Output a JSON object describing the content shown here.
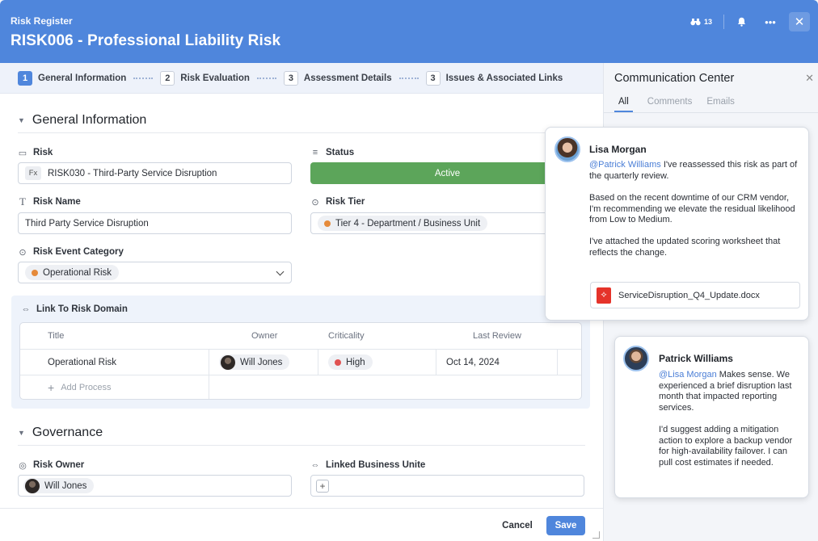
{
  "header": {
    "breadcrumb": "Risk Register",
    "title": "RISK006 - Professional Liability Risk",
    "watchers_count": "13",
    "icons": [
      "binoculars-icon",
      "bell-icon",
      "more-icon",
      "close-icon"
    ]
  },
  "steps": [
    {
      "num": "1",
      "label": "General Information"
    },
    {
      "num": "2",
      "label": "Risk Evaluation"
    },
    {
      "num": "3",
      "label": "Assessment Details"
    },
    {
      "num": "3",
      "label": "Issues & Associated Links"
    }
  ],
  "general": {
    "section_title": "General Information",
    "risk_label": "Risk",
    "risk_fx": "Fx",
    "risk_value": "RISK030 - Third-Party Service Disruption",
    "status_label": "Status",
    "status_value": "Active",
    "risk_name_label": "Risk Name",
    "risk_name_value": "Third Party Service Disruption",
    "risk_tier_label": "Risk Tier",
    "risk_tier_value": "Tier 4 - Department / Business Unit",
    "event_category_label": "Risk Event Category",
    "event_category_value": "Operational Risk"
  },
  "domain": {
    "title": "Link To Risk Domain",
    "columns": [
      "Title",
      "Owner",
      "Criticality",
      "Last Review"
    ],
    "row": {
      "title": "Operational Risk",
      "owner": "Will Jones",
      "criticality": "High",
      "last_review": "Oct 14, 2024"
    },
    "add_label": "Add Process"
  },
  "governance": {
    "section_title": "Governance",
    "owner_label": "Risk Owner",
    "owner_value": "Will Jones",
    "linked_label": "Linked Business Unite"
  },
  "footer": {
    "cancel": "Cancel",
    "save": "Save"
  },
  "comm": {
    "title": "Communication Center",
    "tabs": [
      "All",
      "Comments",
      "Emails"
    ],
    "comments": [
      {
        "author": "Lisa Morgan",
        "mention": "@Patrick Williams",
        "line1": " I've reassessed this risk as part of the quarterly review.",
        "para2": "Based on the recent downtime of our CRM vendor, I'm recommending we elevate the residual likelihood from Low to Medium.",
        "para3": "I've attached the updated scoring worksheet that reflects the change.",
        "attachment": "ServiceDisruption_Q4_Update.docx"
      },
      {
        "author": "Patrick Williams",
        "mention": "@Lisa Morgan",
        "line1": " Makes sense. We experienced a brief disruption last month that impacted reporting services.",
        "para2": "I'd suggest adding a mitigation action to explore a backup vendor for high-availability failover. I can pull cost estimates if needed."
      }
    ]
  },
  "colors": {
    "brand": "#4f86dc",
    "status_active": "#5ca55a",
    "category_dot": "#e58a3a",
    "tier_dot": "#e58a3a",
    "criticality_high": "#e05252"
  }
}
